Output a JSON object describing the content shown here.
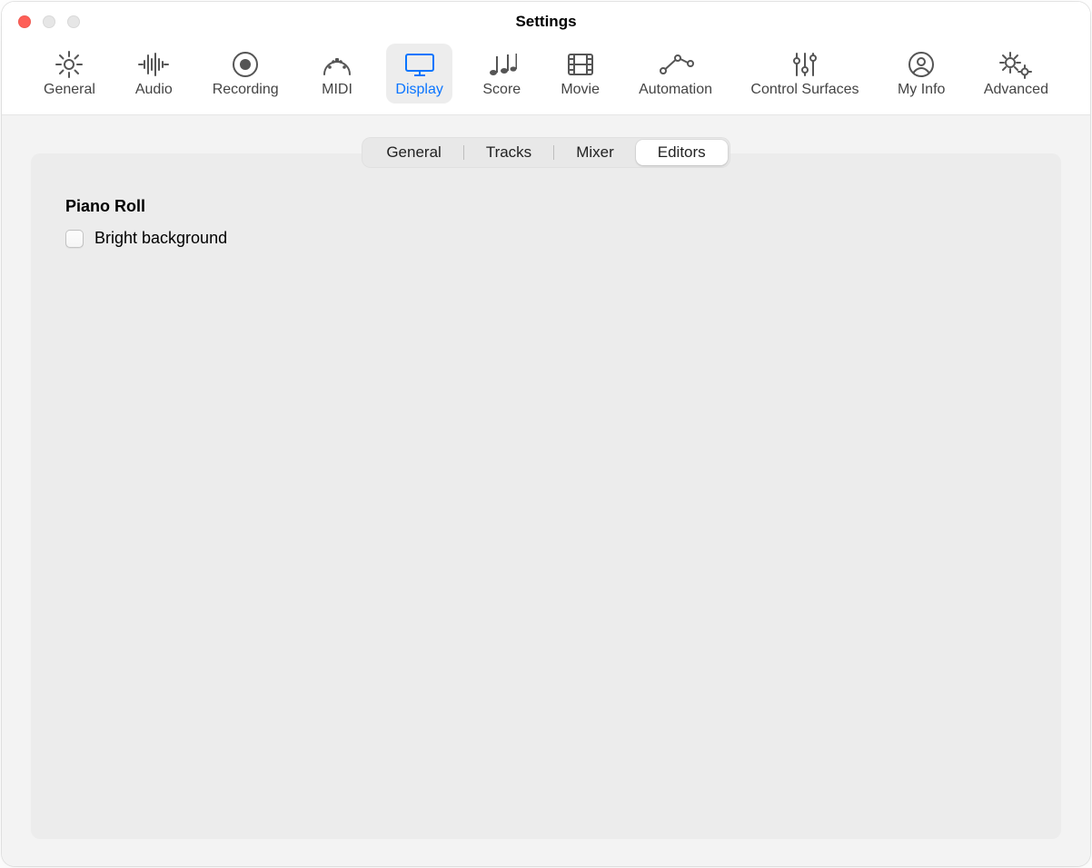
{
  "window": {
    "title": "Settings"
  },
  "toolbar": {
    "items": [
      {
        "label": "General"
      },
      {
        "label": "Audio"
      },
      {
        "label": "Recording"
      },
      {
        "label": "MIDI"
      },
      {
        "label": "Display"
      },
      {
        "label": "Score"
      },
      {
        "label": "Movie"
      },
      {
        "label": "Automation"
      },
      {
        "label": "Control Surfaces"
      },
      {
        "label": "My Info"
      },
      {
        "label": "Advanced"
      }
    ],
    "selected": "Display"
  },
  "tabs": {
    "items": [
      "General",
      "Tracks",
      "Mixer",
      "Editors"
    ],
    "selected": "Editors"
  },
  "panel": {
    "section_title": "Piano Roll",
    "options": {
      "bright_background": {
        "label": "Bright background",
        "checked": false
      }
    }
  },
  "colors": {
    "accent": "#0a75ff"
  }
}
